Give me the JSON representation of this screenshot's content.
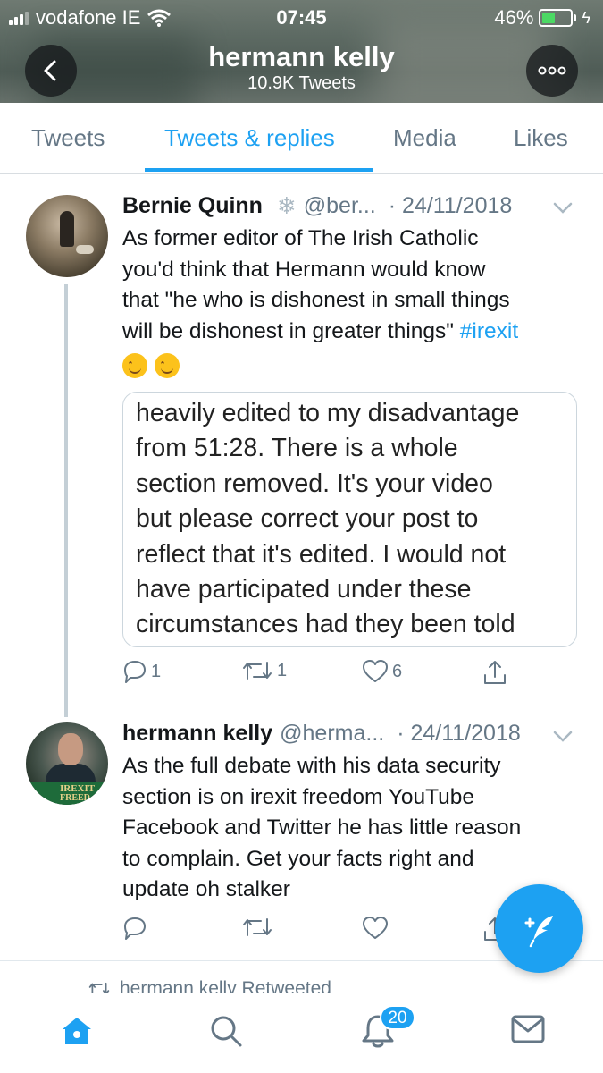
{
  "status_bar": {
    "carrier": "vodafone IE",
    "time": "07:45",
    "battery": "46%",
    "battery_level": 0.46
  },
  "header": {
    "profile_name": "hermann kelly",
    "tweet_count": "10.9K Tweets",
    "back_icon": "chevron-left-icon",
    "more_icon": "more-icon"
  },
  "tabs": [
    {
      "label": "Tweets",
      "active": false
    },
    {
      "label": "Tweets & replies",
      "active": true
    },
    {
      "label": "Media",
      "active": false
    },
    {
      "label": "Likes",
      "active": false
    }
  ],
  "tweets": [
    {
      "name": "Bernie Quinn",
      "badge_icon": "snowflake-icon",
      "handle": "@ber...",
      "date": "· 24/11/2018",
      "text_lines": [
        "As former editor of The Irish Catholic",
        "you'd think that Hermann would know",
        "that \"he who is dishonest in small things",
        "will be dishonest in greater things\""
      ],
      "hashtag": "#irexit",
      "emoji": [
        "smiling-face",
        "smiling-face"
      ],
      "quote_lines": [
        "heavily edited to my disadvantage",
        "from 51:28. There is a whole",
        "section removed. It's your video",
        "but please correct your post to",
        "reflect that it's edited. I would not",
        "have participated under these",
        "circumstances had they been told"
      ],
      "replies": "1",
      "retweets": "1",
      "likes": "6"
    },
    {
      "name": "hermann kelly",
      "handle": "@herma...",
      "date": "· 24/11/2018",
      "avatar_text": "IREXIT",
      "avatar_text2": "FREED",
      "text_lines": [
        "As the full debate with his data security",
        "section is on irexit freedom YouTube",
        "Facebook and Twitter he has little reason",
        "to complain. Get your facts right and",
        "update oh stalker"
      ]
    }
  ],
  "retweeted_label": "hermann kelly Retweeted",
  "nav": {
    "notifications_badge": "20",
    "items": [
      "home-icon",
      "search-icon",
      "bell-icon",
      "mail-icon"
    ]
  },
  "colors": {
    "accent": "#1da1f2",
    "text": "#14171a",
    "muted": "#657786"
  }
}
